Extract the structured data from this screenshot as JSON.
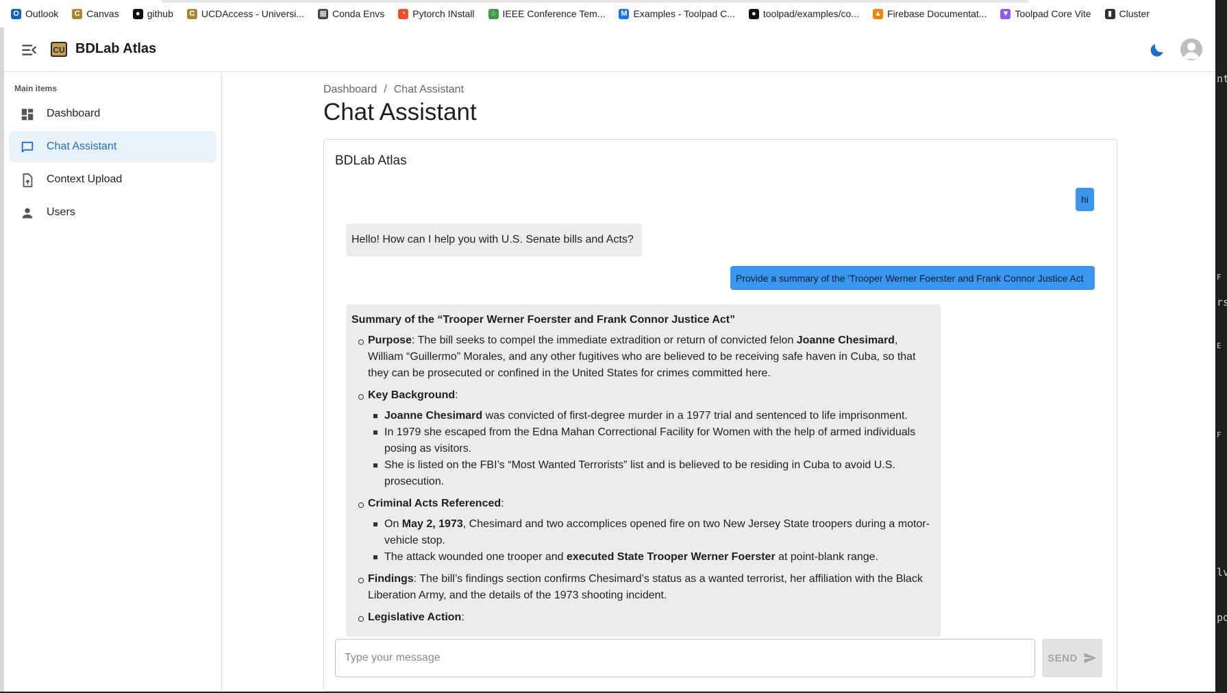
{
  "bookmarks": [
    {
      "label": "Outlook",
      "icon": "outlook-icon",
      "color": "#0a64c2"
    },
    {
      "label": "Canvas",
      "icon": "cu-logo-icon",
      "color": "#a88a2e"
    },
    {
      "label": "github",
      "icon": "github-icon",
      "color": "#111111"
    },
    {
      "label": "UCDAccess - Universi...",
      "icon": "cu-logo-icon",
      "color": "#a88a2e"
    },
    {
      "label": "Conda Envs",
      "icon": "table-icon",
      "color": "#444444"
    },
    {
      "label": "Pytorch INstall",
      "icon": "pytorch-icon",
      "color": "#e8502f"
    },
    {
      "label": "IEEE Conference Tem...",
      "icon": "overleaf-icon",
      "color": "#3f9a45"
    },
    {
      "label": "Examples - Toolpad C...",
      "icon": "mui-icon",
      "color": "#1a73e8"
    },
    {
      "label": "toolpad/examples/co...",
      "icon": "github-icon",
      "color": "#111111"
    },
    {
      "label": "Firebase Documentat...",
      "icon": "firebase-icon",
      "color": "#f5820b"
    },
    {
      "label": "Toolpad Core Vite",
      "icon": "vite-icon",
      "color": "#8c5cf5"
    },
    {
      "label": "Cluster",
      "icon": "book-icon",
      "color": "#333333"
    }
  ],
  "appbar": {
    "title": "BDLab Atlas"
  },
  "sidebar": {
    "subheader": "Main items",
    "items": [
      {
        "label": "Dashboard",
        "icon": "dashboard-icon"
      },
      {
        "label": "Chat Assistant",
        "icon": "chat-icon"
      },
      {
        "label": "Context Upload",
        "icon": "upload-file-icon"
      },
      {
        "label": "Users",
        "icon": "person-icon"
      }
    ],
    "active_index": 1,
    "accent": "#1d6fc4"
  },
  "breadcrumb": [
    "Dashboard",
    "/",
    "Chat Assistant"
  ],
  "page": {
    "title": "Chat Assistant"
  },
  "chat": {
    "title": "BDLab Atlas",
    "messages": [
      {
        "role": "user",
        "text": "hi"
      },
      {
        "role": "assistant",
        "text": "Hello! How can I help you with U.S. Senate bills and Acts?"
      },
      {
        "role": "user",
        "text": "Provide a summary of the 'Trooper Werner Foerster and Frank Connor Justice Act"
      }
    ],
    "summary": {
      "heading": "Summary of the “Trooper Werner Foerster and Frank Connor Justice Act”",
      "purpose_label": "Purpose",
      "purpose_pre": ": The bill seeks to compel the immediate extradition or return of convicted felon ",
      "purpose_bold": "Joanne Chesimard",
      "purpose_post": ", William “Guillermo” Morales, and any other fugitives who are believed to be receiving safe haven in Cuba, so that they can be prosecuted or confined in the United States for crimes committed here.",
      "background_label": "Key Background",
      "background_1_bold": "Joanne Chesimard",
      "background_1_rest": " was convicted of first-degree murder in a 1977 trial and sentenced to life imprisonment.",
      "background_2": "In 1979 she escaped from the Edna Mahan Correctional Facility for Women with the help of armed individuals posing as visitors.",
      "background_3": "She is listed on the FBI’s “Most Wanted Terrorists” list and is believed to be residing in Cuba to avoid U.S. prosecution.",
      "criminal_label": "Criminal Acts Referenced",
      "criminal_1_pre": "On ",
      "criminal_1_bold": "May 2, 1973",
      "criminal_1_post": ", Chesimard and two accomplices opened fire on two New Jersey State troopers during a motor-vehicle stop.",
      "criminal_2_pre": "The attack wounded one trooper and ",
      "criminal_2_bold": "executed State Trooper Werner Foerster",
      "criminal_2_post": " at point-blank range.",
      "findings_label": "Findings",
      "findings_text": ": The bill’s findings section confirms Chesimard’s status as a wanted terrorist, her affiliation with the Black Liberation Army, and the details of the 1973 shooting incident.",
      "legislative_label": "Legislative Action",
      "colon": ":"
    },
    "input_placeholder": "Type your message",
    "input_value": "",
    "send_label": "SEND",
    "user_bubble_color": "#3a96ef",
    "bot_bubble_color": "#ececec"
  },
  "terminal_fragments": [
    "nt",
    "F",
    "rs",
    "E",
    "F",
    "lv",
    "po"
  ]
}
